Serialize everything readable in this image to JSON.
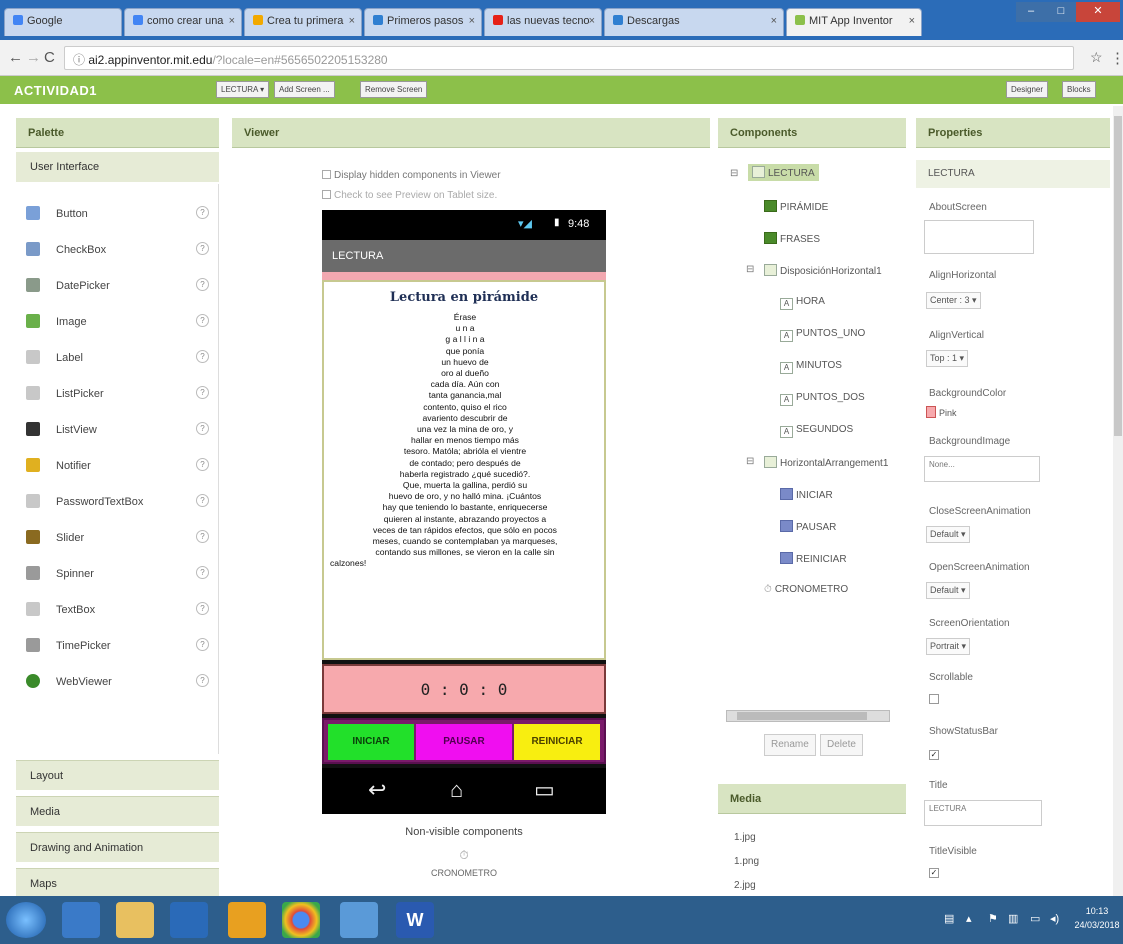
{
  "browser": {
    "tabs": [
      {
        "label": "Google",
        "color": "#4285f4"
      },
      {
        "label": "como crear una",
        "color": "#4285f4"
      },
      {
        "label": "Crea tu primera",
        "color": "#f2a900"
      },
      {
        "label": "Primeros pasos",
        "color": "#2f7fd1"
      },
      {
        "label": "las nuevas tecno",
        "color": "#e62117"
      },
      {
        "label": "Descargas",
        "color": "#2f7fd1"
      },
      {
        "label": "MIT App Inventor",
        "color": "#8cc04a"
      }
    ],
    "url_host": "ai2.appinventor.mit.edu",
    "url_rest": "/?locale=en#5656502205153280"
  },
  "app": {
    "project_name": "ACTIVIDAD1",
    "screen_dropdown": "LECTURA ▾",
    "add_screen": "Add Screen ...",
    "remove_screen": "Remove Screen",
    "designer": "Designer",
    "blocks": "Blocks"
  },
  "palette": {
    "header": "Palette",
    "group": "User Interface",
    "items": [
      {
        "label": "Button",
        "color": "#7aa0d8"
      },
      {
        "label": "CheckBox",
        "color": "#7a9ac8"
      },
      {
        "label": "DatePicker",
        "color": "#8a9a8a"
      },
      {
        "label": "Image",
        "color": "#6ab04a"
      },
      {
        "label": "Label",
        "color": "#c8c8c8"
      },
      {
        "label": "ListPicker",
        "color": "#c8c8c8"
      },
      {
        "label": "ListView",
        "color": "#333333"
      },
      {
        "label": "Notifier",
        "color": "#e0b020"
      },
      {
        "label": "PasswordTextBox",
        "color": "#c8c8c8"
      },
      {
        "label": "Slider",
        "color": "#8a6a20"
      },
      {
        "label": "Spinner",
        "color": "#9a9a9a"
      },
      {
        "label": "TextBox",
        "color": "#c8c8c8"
      },
      {
        "label": "TimePicker",
        "color": "#9a9a9a"
      },
      {
        "label": "WebViewer",
        "color": "#3a8a2a"
      }
    ],
    "groups_below": [
      "Layout",
      "Media",
      "Drawing and Animation",
      "Maps"
    ]
  },
  "viewer": {
    "header": "Viewer",
    "display_hidden": "Display hidden components in Viewer",
    "tablet_preview": "Check to see Preview on Tablet size.",
    "phone_time": "9:48",
    "screen_title": "LECTURA",
    "reading_title": "Lectura en pirámide",
    "reading_lines": [
      "Érase",
      "u n a",
      "g a l l i n a",
      "que    ponía",
      "un  huevo  de",
      "oro   al   dueño",
      "cada día. Aún con",
      "tanta   ganancia,mal",
      "contento, quiso el rico",
      "avariento    descubrir    de",
      "una vez la mina de oro, y",
      "hallar en menos tiempo más",
      "tesoro. Matóla; abrióla el vientre",
      "de  contado;  pero  después  de",
      "haberla  registrado  ¿qué  sucedió?.",
      "Que,   muerta   la   gallina,    perdió   su",
      "huevo de oro, y no halló mina. ¡Cuántos",
      "hay que teniendo lo bastante, enriquecerse",
      "quieren  al  instante,  abrazando  proyectos  a",
      "veces de tan rápidos efectos, que sólo en pocos",
      "meses, cuando se contemplaban ya marqueses,",
      "contando  sus  millones,  se  vieron  en  la  calle  sin",
      "calzones!"
    ],
    "timer": "0 : 0 : 0",
    "btn_iniciar": "INICIAR",
    "btn_pausar": "PAUSAR",
    "btn_reiniciar": "REINICIAR",
    "nonvisible_label": "Non-visible components",
    "nonvisible_item": "CRONOMETRO"
  },
  "components": {
    "header": "Components",
    "root": "LECTURA",
    "piramide": "PIRÁMIDE",
    "frases": "FRASES",
    "h1": "DisposiciónHorizontal1",
    "hora": "HORA",
    "puntos_uno": "PUNTOS_UNO",
    "minutos": "MINUTOS",
    "puntos_dos": "PUNTOS_DOS",
    "segundos": "SEGUNDOS",
    "h2": "HorizontalArrangement1",
    "iniciar": "INICIAR",
    "pausar": "PAUSAR",
    "reiniciar": "REINICIAR",
    "crono": "CRONOMETRO",
    "rename": "Rename",
    "delete": "Delete"
  },
  "media": {
    "header": "Media",
    "files": [
      "1.jpg",
      "1.png",
      "2.jpg"
    ]
  },
  "properties": {
    "header": "Properties",
    "component": "LECTURA",
    "about": "AboutScreen",
    "align_h": "AlignHorizontal",
    "align_h_val": "Center : 3 ▾",
    "align_v": "AlignVertical",
    "align_v_val": "Top : 1 ▾",
    "bg_color": "BackgroundColor",
    "bg_color_val": "Pink",
    "bg_image": "BackgroundImage",
    "bg_image_val": "None...",
    "close_anim": "CloseScreenAnimation",
    "close_anim_val": "Default ▾",
    "open_anim": "OpenScreenAnimation",
    "open_anim_val": "Default ▾",
    "orientation": "ScreenOrientation",
    "orientation_val": "Portrait ▾",
    "scrollable": "Scrollable",
    "show_status": "ShowStatusBar",
    "title": "Title",
    "title_val": "LECTURA",
    "title_visible": "TitleVisible"
  },
  "taskbar": {
    "time": "10:13",
    "date": "24/03/2018"
  }
}
